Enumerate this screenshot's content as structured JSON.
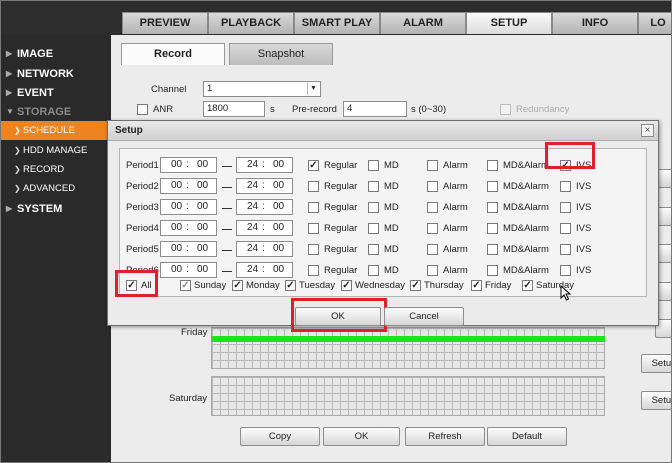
{
  "top_tabs": [
    "PREVIEW",
    "PLAYBACK",
    "SMART PLAY",
    "ALARM",
    "SETUP",
    "INFO",
    "LO"
  ],
  "sidebar": {
    "image": "IMAGE",
    "network": "NETWORK",
    "event": "EVENT",
    "storage": "STORAGE",
    "schedule": "SCHEDULE",
    "hdd_manage": "HDD MANAGE",
    "record": "RECORD",
    "advanced": "ADVANCED",
    "system": "SYSTEM"
  },
  "sub_tabs": {
    "record": "Record",
    "snapshot": "Snapshot"
  },
  "record_form": {
    "channel_label": "Channel",
    "channel_value": "1",
    "anr_label": "ANR",
    "anr_value": "1800",
    "anr_unit": "s",
    "prerecord_label": "Pre-record",
    "prerecord_value": "4",
    "prerecord_unit": "s (0~30)",
    "redundancy_label": "Redundancy"
  },
  "day_rows": {
    "friday": "Friday",
    "saturday": "Saturday"
  },
  "row_button": "Setup",
  "bottom_buttons": {
    "copy": "Copy",
    "ok": "OK",
    "refresh": "Refresh",
    "default": "Default"
  },
  "dialog": {
    "title": "Setup",
    "close_glyph": "×",
    "time_sep": ":",
    "type_labels": {
      "regular": "Regular",
      "md": "MD",
      "alarm": "Alarm",
      "md_alarm": "MD&Alarm",
      "ivs": "IVS"
    },
    "periods": [
      {
        "label": "Period1",
        "start_h": "00",
        "start_m": "00",
        "end_h": "24",
        "end_m": "00",
        "regular": true,
        "md": false,
        "alarm": false,
        "md_alarm": false,
        "ivs": true
      },
      {
        "label": "Period2",
        "start_h": "00",
        "start_m": "00",
        "end_h": "24",
        "end_m": "00",
        "regular": false,
        "md": false,
        "alarm": false,
        "md_alarm": false,
        "ivs": false
      },
      {
        "label": "Period3",
        "start_h": "00",
        "start_m": "00",
        "end_h": "24",
        "end_m": "00",
        "regular": false,
        "md": false,
        "alarm": false,
        "md_alarm": false,
        "ivs": false
      },
      {
        "label": "Period4",
        "start_h": "00",
        "start_m": "00",
        "end_h": "24",
        "end_m": "00",
        "regular": false,
        "md": false,
        "alarm": false,
        "md_alarm": false,
        "ivs": false
      },
      {
        "label": "Period5",
        "start_h": "00",
        "start_m": "00",
        "end_h": "24",
        "end_m": "00",
        "regular": false,
        "md": false,
        "alarm": false,
        "md_alarm": false,
        "ivs": false
      },
      {
        "label": "Period6",
        "start_h": "00",
        "start_m": "00",
        "end_h": "24",
        "end_m": "00",
        "regular": false,
        "md": false,
        "alarm": false,
        "md_alarm": false,
        "ivs": false
      }
    ],
    "all_label": "All",
    "days": [
      "Sunday",
      "Monday",
      "Tuesday",
      "Wednesday",
      "Thursday",
      "Friday",
      "Saturday"
    ],
    "ok_label": "OK",
    "cancel_label": "Cancel"
  },
  "highlight_color": "#e01e2c",
  "accent_color": "#ee8420",
  "timeline_color": "#15e815"
}
